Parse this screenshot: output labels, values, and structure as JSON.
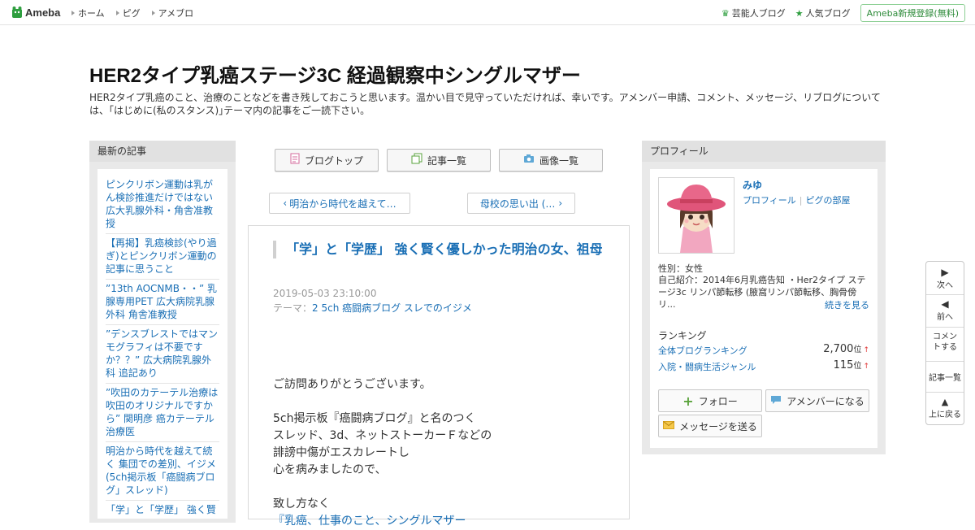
{
  "header": {
    "logo_text": "Ameba",
    "nav": [
      "ホーム",
      "ピグ",
      "アメブロ"
    ],
    "right_links": [
      "芸能人ブログ",
      "人気ブログ"
    ],
    "register": "Ameba新規登録(無料)"
  },
  "blog": {
    "title": "HER2タイプ乳癌ステージ3C 経過観察中シングルマザー",
    "description": "HER2タイプ乳癌のこと、治療のことなどを書き残しておこうと思います。温かい目で見守っていただければ、幸いです。アメンバー申請、コメント、メッセージ、リブログについては、｢はじめに(私のスタンス)｣テーマ内の記事をご一読下さい。"
  },
  "left_sidebar": {
    "title": "最新の記事",
    "items": [
      "ピンクリボン運動は乳がん検診推進だけではない 広大乳腺外科・角舎准教授",
      "【再掲】乳癌検診(やり過ぎ)とピンクリボン運動の記事に思うこと",
      "”13th AOCNMB・・” 乳腺専用PET 広大病院乳腺外科 角舎准教授",
      "”デンスブレストではマンモグラフィは不要ですか？？” 広大病院乳腺外科 追記あり",
      "”吹田のカテーテル治療は吹田のオリジナルですから” 関明彦 癌カテーテル治療医",
      "明治から時代を越えて続く 集団での差別、イジメ(5ch掲示板「癌闘病ブログ」スレッド)",
      "「学」と「学歴」 強く賢"
    ]
  },
  "center": {
    "buttons": [
      "ブログトップ",
      "記事一覧",
      "画像一覧"
    ],
    "prev": "明治から時代を越えて…",
    "next": "母校の思い出 (…",
    "article": {
      "title": "「学」と「学歴」 強く賢く優しかった明治の女、祖母",
      "date": "2019-05-03 23:10:00",
      "theme_label": "テーマ：",
      "theme": "2 5ch 癌闘病ブログ スレでのイジメ",
      "body": [
        "",
        "ご訪問ありがとうございます。",
        "",
        "5ch掲示板『癌闘病ブログ』と名のつく",
        "スレッド、3d、ネットストーカーＦなどの",
        "誹謗中傷がエスカレートし",
        "心を病みましたので、",
        "",
        "致し方なく"
      ],
      "body_link": "『乳癌、仕事のこと、シングルマザー"
    }
  },
  "profile": {
    "title": "プロフィール",
    "name": "みゆ",
    "link1": "プロフィール",
    "link2": "ピグの部屋",
    "gender": "性別：女性",
    "intro": "自己紹介：2014年6月乳癌告知 ・Her2タイプ ステージ3c リンパ節転移 (腋窩リンパ節転移、胸骨傍リ...",
    "more": "続きを見る",
    "ranking_title": "ランキング",
    "rankings": [
      {
        "label": "全体ブログランキング",
        "value": "2,700",
        "unit": "位",
        "arrow": "↑"
      },
      {
        "label": "入院・闘病生活ジャンル",
        "value": "115",
        "unit": "位",
        "arrow": "↑"
      }
    ],
    "follow": "フォロー",
    "amember": "アメンバーになる",
    "message": "メッセージを送る"
  },
  "floatnav": {
    "next": "次へ",
    "prev": "前へ",
    "comment": "コメントする",
    "list": "記事一覧",
    "top": "上に戻る"
  }
}
